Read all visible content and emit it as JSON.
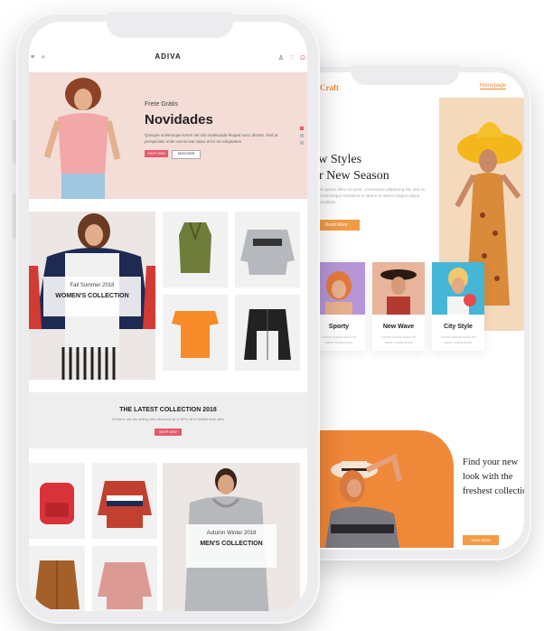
{
  "back_phone": {
    "logo": "eCraft",
    "menu_label": "Homepage",
    "hero_title_line1": "ew Styles",
    "hero_title_line2": "or New Season",
    "hero_desc": "Lorem ipsum dolor sit amet, consectetur adipiscing elit, sed do eiusmod tempor incididunt ut labore et dolore magna aliqua suspendisse",
    "hero_button": "Read More",
    "categories": [
      {
        "name": "Sporty",
        "sub": "Lorem ipsum dolor sit amet consectetur"
      },
      {
        "name": "New Wave",
        "sub": "Lorem ipsum dolor sit amet consectetur"
      },
      {
        "name": "City Style",
        "sub": "Lorem ipsum dolor sit amet consectetur"
      }
    ],
    "promo_text": "Find your new look with the freshest collection",
    "promo_button": "View More"
  },
  "front_phone": {
    "nav": {
      "logo": "ADIVA",
      "menu_icon": "≡",
      "search_icon": "⌕",
      "user_icon": "♙",
      "heart_icon": "♡",
      "cart_icon": "⊡"
    },
    "hero": {
      "subtitle": "Frete Grátis",
      "title": "Novidades",
      "desc": "Quisque scelerisque lorem vel nisi malesuada feugiat nunc dictum. Sed ut perspiciatis unde omnis iste natus error sit voluptatem",
      "btn_shop": "SHOP NOW",
      "btn_discover": "DISCOVER"
    },
    "women": {
      "subtitle": "Fall Summer 2018",
      "title": "WOMEN'S COLLECTION"
    },
    "latest": {
      "title": "THE LATEST COLLECTION 2018",
      "desc": "Hi there, we are selling with discount up to 50% off in limited time offer",
      "button": "SHOP NOW"
    },
    "men": {
      "subtitle": "Autumn Winter 2018",
      "title": "MEN'S COLLECTION"
    }
  },
  "colors": {
    "accent_pink": "#e65a6c",
    "accent_orange": "#f39b45",
    "hero_bg": "#f3ddd6"
  }
}
